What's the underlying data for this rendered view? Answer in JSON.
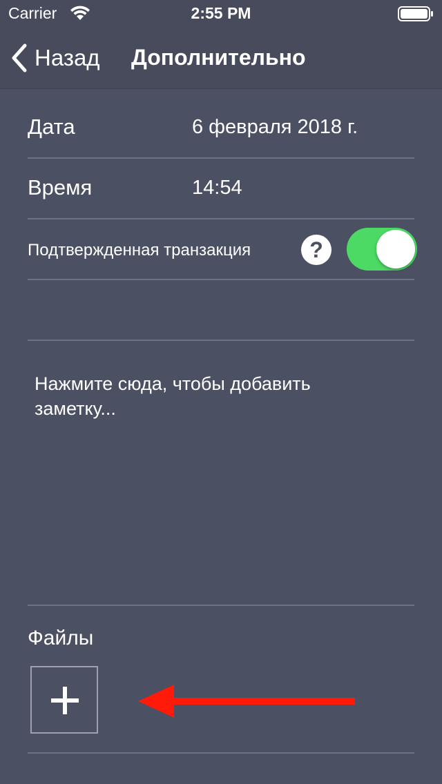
{
  "status_bar": {
    "carrier": "Carrier",
    "time": "2:55 PM",
    "wifi_icon": "wifi-icon",
    "battery_icon": "battery-icon"
  },
  "nav": {
    "back_label": "Назад",
    "title": "Дополнительно",
    "back_icon": "chevron-left-icon"
  },
  "fields": {
    "date": {
      "label": "Дата",
      "value": "6 февраля 2018 г."
    },
    "time": {
      "label": "Время",
      "value": "14:54"
    },
    "confirmed": {
      "label": "Подтвержденная транзакция",
      "help": "?",
      "enabled": true
    }
  },
  "note": {
    "placeholder": "Нажмите сюда, чтобы добавить заметку..."
  },
  "files": {
    "label": "Файлы",
    "add_icon": "plus-icon",
    "annotation_icon": "arrow-left-icon"
  },
  "colors": {
    "background": "#4b5063",
    "toggle_on": "#4cd964",
    "arrow": "#ff1a0a"
  }
}
